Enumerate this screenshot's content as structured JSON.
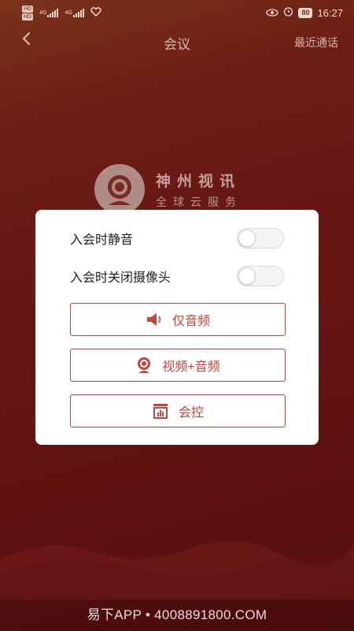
{
  "status_bar": {
    "hd_top": "HD",
    "hd_bottom": "HD",
    "network1": "4G",
    "network2": "4G",
    "battery": "80",
    "time": "16:27"
  },
  "header": {
    "title": "会议",
    "recent_link": "最近通话"
  },
  "logo": {
    "line1": "神州视讯",
    "line2": "全球云服务"
  },
  "dialog": {
    "options": [
      {
        "label": "入会时静音",
        "on": false
      },
      {
        "label": "入会时关闭摄像头",
        "on": false
      }
    ],
    "buttons": [
      {
        "label": "仅音频",
        "icon": "speaker-icon"
      },
      {
        "label": "视频+音频",
        "icon": "webcam-icon"
      },
      {
        "label": "会控",
        "icon": "control-panel-icon"
      }
    ],
    "accent_color": "#c9433b"
  },
  "watermark": "易下APP • 4008891800.COM"
}
